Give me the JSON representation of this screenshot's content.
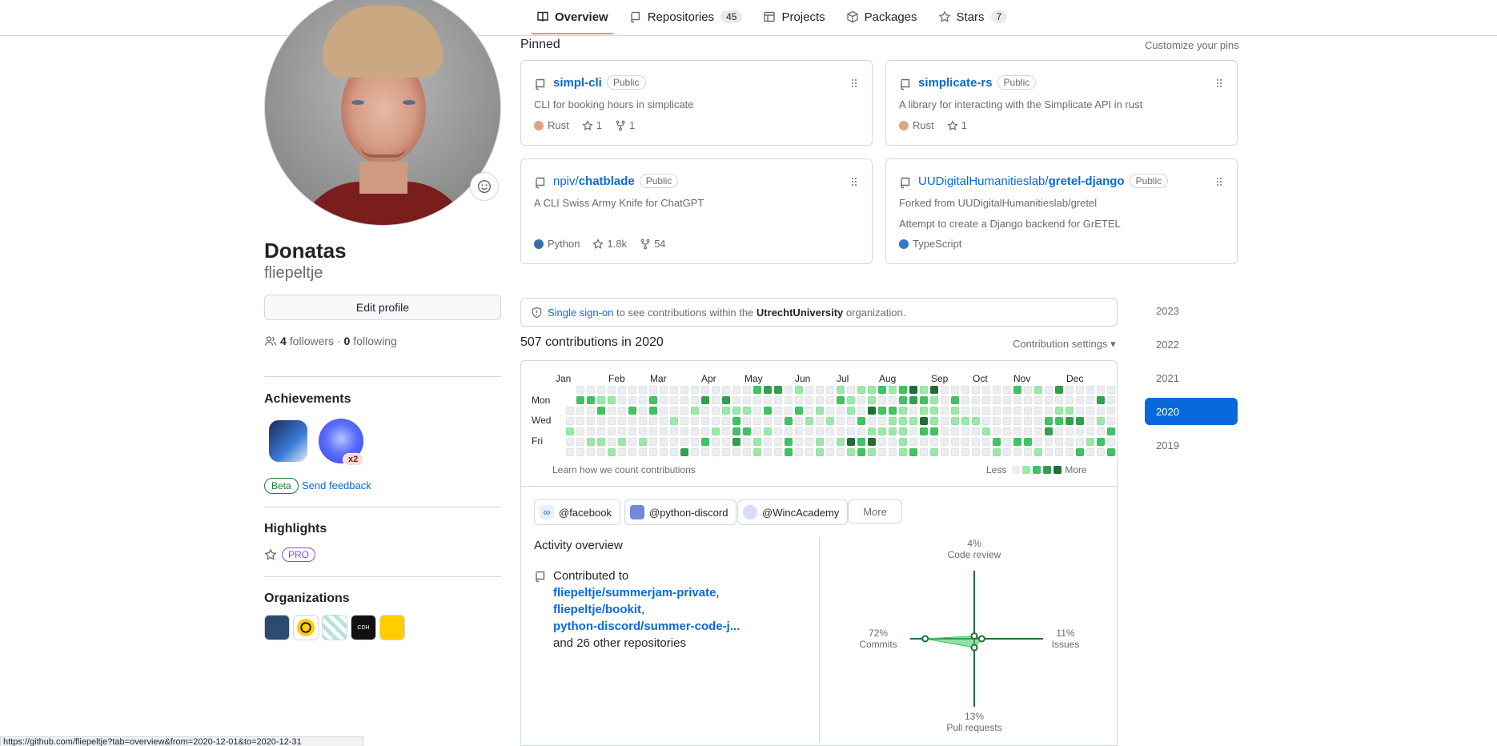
{
  "nav": {
    "tabs": [
      {
        "label": "Overview",
        "count": null
      },
      {
        "label": "Repositories",
        "count": "45"
      },
      {
        "label": "Projects",
        "count": null
      },
      {
        "label": "Packages",
        "count": null
      },
      {
        "label": "Stars",
        "count": "7"
      }
    ]
  },
  "profile": {
    "name": "Donatas",
    "login": "fliepeltje",
    "edit_label": "Edit profile",
    "followers_count": "4",
    "followers_label": "followers",
    "following_count": "0",
    "following_label": "following"
  },
  "achievements": {
    "title": "Achievements",
    "multiplier": "x2",
    "beta_label": "Beta",
    "feedback_label": "Send feedback"
  },
  "highlights": {
    "title": "Highlights",
    "pro_label": "PRO"
  },
  "organizations": {
    "title": "Organizations",
    "cdh_label": "CDH"
  },
  "pinned": {
    "label": "Pinned",
    "customize": "Customize your pins",
    "badge": "Public",
    "cards": [
      {
        "ns": "",
        "name": "simpl-cli",
        "desc": "CLI for booking hours in simplicate",
        "desc2": "",
        "lang": "Rust",
        "lang_color": "#dea584",
        "stars": "1",
        "forks": "1"
      },
      {
        "ns": "",
        "name": "simplicate-rs",
        "desc": "A library for interacting with the Simplicate API in rust",
        "desc2": "",
        "lang": "Rust",
        "lang_color": "#dea584",
        "stars": "1",
        "forks": ""
      },
      {
        "ns": "npiv/",
        "name": "chatblade",
        "desc": "A CLI Swiss Army Knife for ChatGPT",
        "desc2": "",
        "lang": "Python",
        "lang_color": "#3572A5",
        "stars": "1.8k",
        "forks": "54"
      },
      {
        "ns": "UUDigitalHumanitieslab/",
        "name": "gretel-django",
        "desc": "Forked from UUDigitalHumanitieslab/gretel",
        "desc2": "Attempt to create a Django backend for GrETEL",
        "lang": "TypeScript",
        "lang_color": "#3178c6",
        "stars": "",
        "forks": ""
      }
    ]
  },
  "sso": {
    "link": "Single sign-on",
    "text_before": "to see contributions within the",
    "org": "UtrechtUniversity",
    "text_after": "organization."
  },
  "contributions": {
    "title": "507 contributions in 2020",
    "settings_label": "Contribution settings ▾",
    "months": [
      "Jan",
      "Feb",
      "Mar",
      "Apr",
      "May",
      "Jun",
      "Jul",
      "Aug",
      "Sep",
      "Oct",
      "Nov",
      "Dec"
    ],
    "days": [
      "Mon",
      "Wed",
      "Fri"
    ],
    "learn_label": "Learn how we count contributions",
    "less_label": "Less",
    "more_label": "More",
    "level_colors": [
      "#ebedf0",
      "#9be9a8",
      "#40c463",
      "#30a14e",
      "#216e39"
    ]
  },
  "activity": {
    "org_buttons": [
      {
        "label": "@facebook",
        "color": "#0866ff"
      },
      {
        "label": "@python-discord",
        "color": "#7289da"
      },
      {
        "label": "@WincAcademy",
        "color": "#5b6bc0"
      }
    ],
    "more_label": "More",
    "title": "Activity overview",
    "contributed_to": "Contributed to",
    "repos": [
      "fliepeltje/summerjam-private",
      "fliepeltje/bookit",
      "python-discord/summer-code-j..."
    ],
    "others": "and 26 other repositories",
    "radar": {
      "code_review_pct": "4%",
      "code_review_label": "Code review",
      "issues_pct": "11%",
      "issues_label": "Issues",
      "commits_pct": "72%",
      "commits_label": "Commits",
      "prs_pct": "13%",
      "prs_label": "Pull requests",
      "values": {
        "code_review": 4,
        "issues": 11,
        "commits": 72,
        "prs": 13
      }
    }
  },
  "years": [
    "2023",
    "2022",
    "2021",
    "2020",
    "2019"
  ],
  "selected_year": "2020",
  "status_url": "https://github.com/fliepeltje?tab=overview&from=2020-12-01&to=2020-12-31"
}
